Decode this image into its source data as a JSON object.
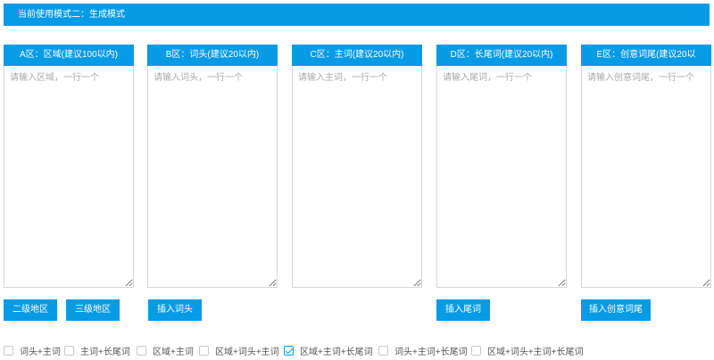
{
  "mode_bar": {
    "text": "当前使用模式二：生成模式"
  },
  "columns": [
    {
      "header": "A区：区域(建议100以内)",
      "placeholder": "请输入区域，一行一个"
    },
    {
      "header": "B区：词头(建议20以内)",
      "placeholder": "请输入词头，一行一个"
    },
    {
      "header": "C区：主词(建议20以内)",
      "placeholder": "请输入主词，一行一个"
    },
    {
      "header": "D区：长尾词(建议20以内)",
      "placeholder": "请输入尾词，一行一个"
    },
    {
      "header": "E区：创意词尾(建议20以",
      "placeholder": "请输入创意词尾，一行一个"
    }
  ],
  "buttons": {
    "level2_region": "二级地区",
    "level3_region": "三级地区",
    "insert_head": "插入词头",
    "insert_tail": "插入尾词",
    "insert_creative_tail": "插入创意词尾"
  },
  "options": [
    {
      "label": "词头+主词",
      "checked": false
    },
    {
      "label": "主词+长尾词",
      "checked": false
    },
    {
      "label": "区域+主词",
      "checked": false
    },
    {
      "label": "区域+词头+主词",
      "checked": false
    },
    {
      "label": "区域+主词+长尾词",
      "checked": true
    },
    {
      "label": "词头+主词+长尾词",
      "checked": false
    },
    {
      "label": "区域+词头+主词+长尾词",
      "checked": false
    }
  ],
  "colors": {
    "accent": "#079be6"
  }
}
